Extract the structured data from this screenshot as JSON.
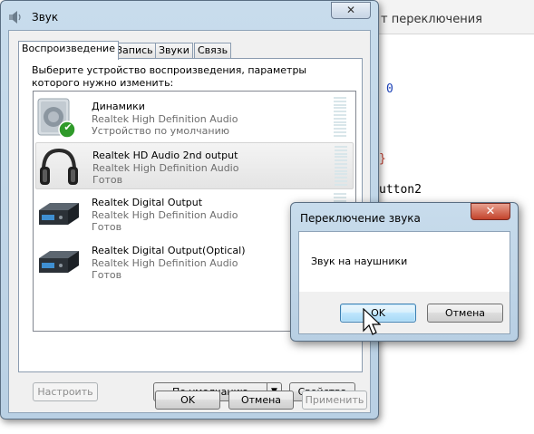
{
  "background_editor": {
    "title_fragment": "т переключения",
    "code_fragments": [
      {
        "text": "0",
        "color": "#1a3fb5"
      },
      {
        "text": "}",
        "color": "#c0392b"
      },
      {
        "text": "utton2",
        "color": "#000000"
      }
    ]
  },
  "main_window": {
    "title": "Звук",
    "close_symbol": "✕",
    "tabs": [
      "Воспроизведение",
      "Запись",
      "Звуки",
      "Связь"
    ],
    "instruction": "Выберите устройство воспроизведения, параметры которого нужно изменить:",
    "devices": [
      {
        "name": "Динамики",
        "driver": "Realtek High Definition Audio",
        "status": "Устройство по умолчанию",
        "icon": "speaker-icon",
        "default_badge": "✔"
      },
      {
        "name": "Realtek HD Audio 2nd output",
        "driver": "Realtek High Definition Audio",
        "status": "Готов",
        "icon": "headphones-icon",
        "selected": true
      },
      {
        "name": "Realtek Digital Output",
        "driver": "Realtek High Definition Audio",
        "status": "Готов",
        "icon": "digital-output-icon"
      },
      {
        "name": "Realtek Digital Output(Optical)",
        "driver": "Realtek High Definition Audio",
        "status": "Готов",
        "icon": "digital-output-icon"
      }
    ],
    "buttons": {
      "configure": "Настроить",
      "set_default": "По умолчанию",
      "set_default_arrow": "▼",
      "properties": "Свойства",
      "ok": "OK",
      "cancel": "Отмена",
      "apply": "Применить"
    }
  },
  "dialog": {
    "title": "Переключение звука",
    "close_symbol": "✕",
    "message": "Звук на наушники",
    "ok": "OK",
    "cancel": "Отмена"
  },
  "colors": {
    "frame": "#c8dcec",
    "close_red": "#c3432b",
    "focus_blue": "#3c7fb1",
    "check_green": "#2f9a2a"
  }
}
